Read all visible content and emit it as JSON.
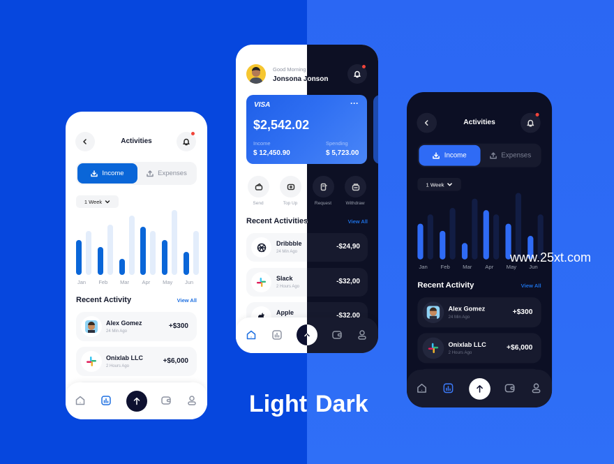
{
  "colors": {
    "bg_left": "#0647de",
    "bg_right": "#2d6cf6",
    "accent_light": "#0a66d8",
    "accent_dark": "#2f6bf5",
    "dark_surface": "#0c0f24",
    "notification": "#f0443a"
  },
  "activities": {
    "title": "Activities",
    "tabs": [
      {
        "label": "Income",
        "icon": "download-icon",
        "active": true
      },
      {
        "label": "Expenses",
        "icon": "upload-icon",
        "active": false
      }
    ],
    "period": "1 Week",
    "chart": {
      "type": "bar",
      "categories": [
        "Jan",
        "Feb",
        "Mar",
        "Apr",
        "May",
        "Jun"
      ],
      "income": [
        50,
        40,
        23,
        69,
        50,
        33
      ],
      "other": [
        63,
        72,
        85,
        63,
        93,
        63
      ]
    },
    "recent_title": "Recent Activity",
    "view_all": "View All",
    "rows": [
      {
        "name": "Alex Gomez",
        "time": "24 Min Ago",
        "amount": "+$300",
        "icon": "memoji-avatar"
      },
      {
        "name": "Onixlab LLC",
        "time": "2 Hours Ago",
        "amount": "+$6,000",
        "icon": "slack-logo-icon"
      }
    ]
  },
  "home": {
    "greeting": "Good Morning",
    "user": "Jonsona Jonson",
    "card": {
      "brand": "VISA",
      "balance": "$2,542.02",
      "income_label": "Income",
      "income": "$ 12,450.90",
      "spending_label": "Spending",
      "spending": "$ 5,723.00"
    },
    "actions": [
      {
        "label": "Send",
        "icon": "wallet-send-icon"
      },
      {
        "label": "Top Up",
        "icon": "top-up-icon"
      },
      {
        "label": "Request",
        "icon": "request-icon"
      },
      {
        "label": "Withdraw",
        "icon": "withdraw-icon"
      }
    ],
    "recent_title": "Recent Activities",
    "view_all": "View All",
    "rows": [
      {
        "name": "Dribbble",
        "time": "24 Min Ago",
        "amount": "-$24,90",
        "icon": "dribbble-icon"
      },
      {
        "name": "Slack",
        "time": "2 Hours Ago",
        "amount": "-$32,00",
        "icon": "slack-logo-icon"
      },
      {
        "name": "Apple",
        "time": "",
        "amount": "-$32,00",
        "icon": "apple-icon"
      }
    ]
  },
  "captions": {
    "light": "Light",
    "dark": "Dark"
  },
  "watermark": "www.25xt.com"
}
